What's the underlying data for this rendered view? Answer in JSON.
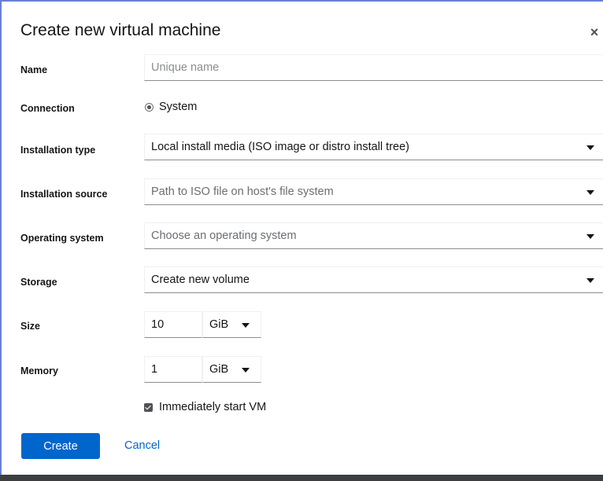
{
  "dialog": {
    "title": "Create new virtual machine",
    "close_icon": "close-icon"
  },
  "form": {
    "name": {
      "label": "Name",
      "placeholder": "Unique name",
      "value": ""
    },
    "connection": {
      "label": "Connection",
      "option": "System",
      "selected": true
    },
    "installation_type": {
      "label": "Installation type",
      "value": "Local install media (ISO image or distro install tree)"
    },
    "installation_source": {
      "label": "Installation source",
      "placeholder": "Path to ISO file on host's file system"
    },
    "operating_system": {
      "label": "Operating system",
      "placeholder": "Choose an operating system"
    },
    "storage": {
      "label": "Storage",
      "value": "Create new volume"
    },
    "size": {
      "label": "Size",
      "value": "10",
      "unit": "GiB"
    },
    "memory": {
      "label": "Memory",
      "value": "1",
      "unit": "GiB"
    },
    "start_vm": {
      "label": "Immediately start VM",
      "checked": true
    }
  },
  "footer": {
    "create_label": "Create",
    "cancel_label": "Cancel"
  },
  "colors": {
    "primary": "#0066cc",
    "border_accent": "#6a7fd6"
  }
}
